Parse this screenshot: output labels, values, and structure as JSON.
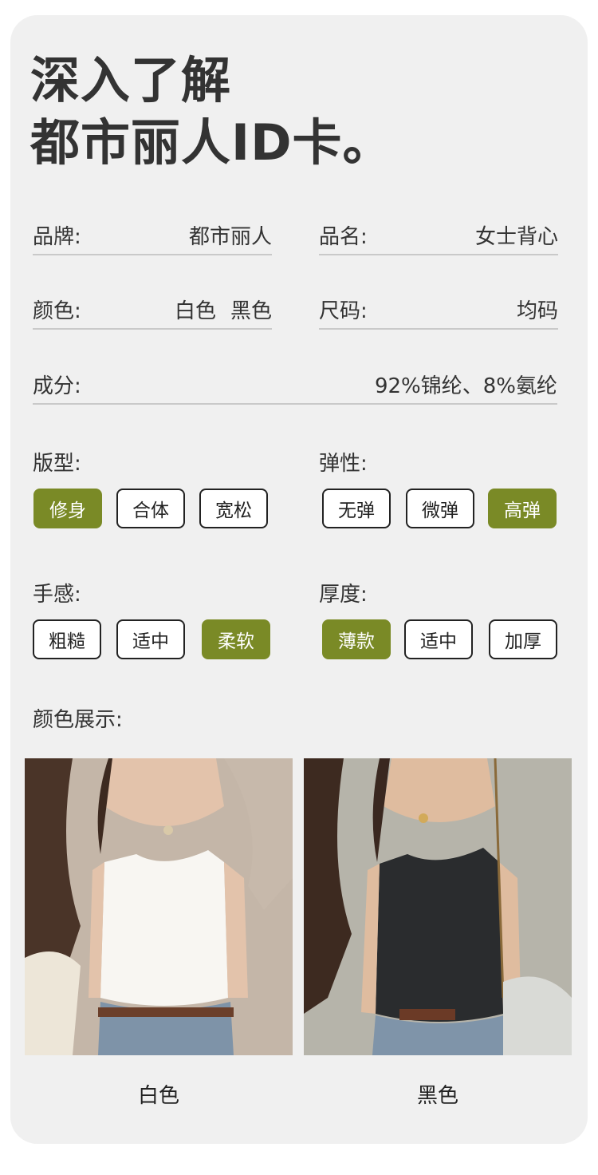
{
  "title": {
    "line1": "深入了解",
    "line2": "都市丽人ID卡。"
  },
  "specs": {
    "brand": {
      "label": "品牌:",
      "value": "都市丽人"
    },
    "product_name": {
      "label": "品名:",
      "value": "女士背心"
    },
    "color": {
      "label": "颜色:",
      "values": [
        "白色",
        "黑色"
      ]
    },
    "size": {
      "label": "尺码:",
      "value": "均码"
    },
    "composition": {
      "label": "成分:",
      "value": "92%锦纶、8%氨纶"
    }
  },
  "attributes": {
    "fit": {
      "label": "版型:",
      "options": [
        "修身",
        "合体",
        "宽松"
      ],
      "selected": "修身"
    },
    "elasticity": {
      "label": "弹性:",
      "options": [
        "无弹",
        "微弹",
        "高弹"
      ],
      "selected": "高弹"
    },
    "hand_feel": {
      "label": "手感:",
      "options": [
        "粗糙",
        "适中",
        "柔软"
      ],
      "selected": "柔软"
    },
    "thickness": {
      "label": "厚度:",
      "options": [
        "薄款",
        "适中",
        "加厚"
      ],
      "selected": "薄款"
    }
  },
  "colors_display": {
    "label": "颜色展示:",
    "items": [
      {
        "caption": "白色",
        "swatch": "#f7f5f0"
      },
      {
        "caption": "黑色",
        "swatch": "#2a2c2e"
      }
    ]
  },
  "accent_color": "#7a8a26"
}
